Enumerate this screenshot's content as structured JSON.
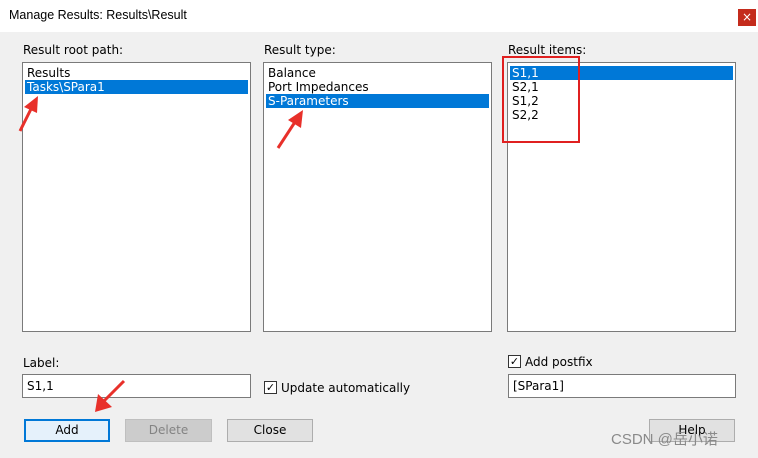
{
  "window": {
    "title": "Manage Results: Results\\Result",
    "close_glyph": "×"
  },
  "root_path": {
    "label": "Result root path:",
    "items": [
      "Results",
      "Tasks\\SPara1"
    ],
    "selected_index": 1
  },
  "result_type": {
    "label": "Result type:",
    "items": [
      "Balance",
      "Port Impedances",
      "S-Parameters"
    ],
    "selected_index": 2
  },
  "result_items": {
    "label": "Result items:",
    "items": [
      "S1,1",
      "S2,1",
      "S1,2",
      "S2,2"
    ],
    "selected_index": 0
  },
  "label_field": {
    "label": "Label:",
    "value": "S1,1"
  },
  "update_automatically": {
    "label": "Update automatically",
    "checked": true,
    "check_glyph": "✓"
  },
  "postfix": {
    "label": "Add postfix",
    "checked": true,
    "check_glyph": "✓",
    "value": "[SPara1]"
  },
  "buttons": {
    "add": "Add",
    "delete": "Delete",
    "close": "Close",
    "help": "Help"
  },
  "annotation": {
    "color": "#e8302a"
  },
  "watermark": {
    "text": "CSDN @岳小诺"
  }
}
